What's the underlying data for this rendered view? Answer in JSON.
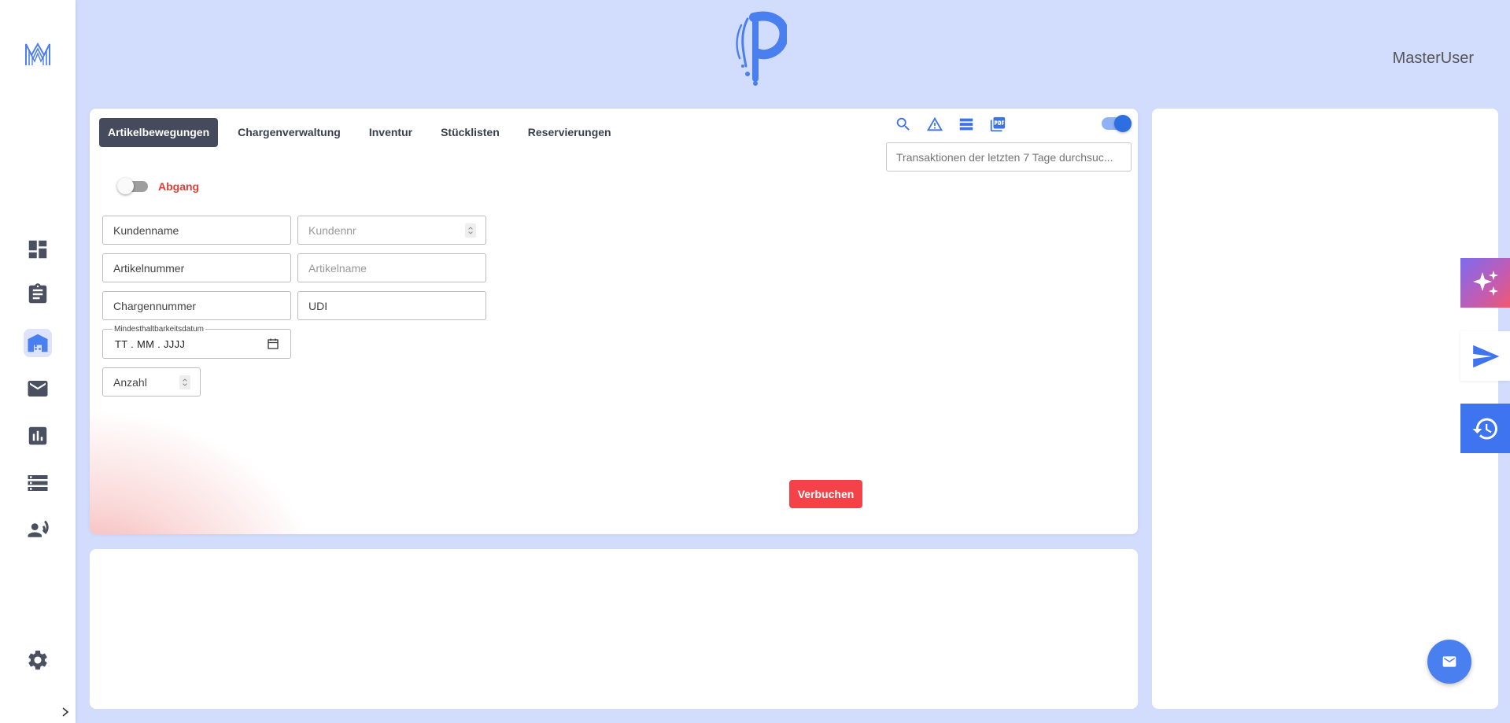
{
  "header": {
    "user_name": "MasterUser"
  },
  "sidebar": {
    "items": [
      {
        "name": "dashboard-icon"
      },
      {
        "name": "clipboard-icon"
      },
      {
        "name": "warehouse-icon"
      },
      {
        "name": "mail-icon"
      },
      {
        "name": "chart-icon"
      },
      {
        "name": "list-icon"
      },
      {
        "name": "people-icon"
      }
    ],
    "settings_icon": "gear-icon",
    "active_item": "warehouse-icon"
  },
  "main": {
    "tabs": [
      {
        "label": "Artikelbewegungen",
        "active": true
      },
      {
        "label": "Chargenverwaltung",
        "active": false
      },
      {
        "label": "Inventur",
        "active": false
      },
      {
        "label": "Stücklisten",
        "active": false
      },
      {
        "label": "Reservierungen",
        "active": false
      }
    ],
    "toolbar_icons": [
      "search-icon",
      "warning-icon",
      "list-icon",
      "pdf-icon"
    ],
    "search_placeholder": "Transaktionen der letzten 7 Tage durchsuc...",
    "mode_label": "Abgang",
    "form": {
      "kundenname": "Kundenname",
      "kundennr": "Kundennr",
      "artikelnummer": "Artikelnummer",
      "artikelname": "Artikelname",
      "chargennummer": "Chargennummer",
      "udi": "UDI",
      "mhd_label": "Mindesthaltbarkeitsdatum",
      "mhd_value": "TT . MM . JJJJ",
      "anzahl": "Anzahl"
    },
    "submit_label": "Verbuchen"
  },
  "colors": {
    "background": "#d2dcfc",
    "accent": "#3f74f0",
    "danger": "#f44248",
    "tab_active": "#454b5c"
  }
}
